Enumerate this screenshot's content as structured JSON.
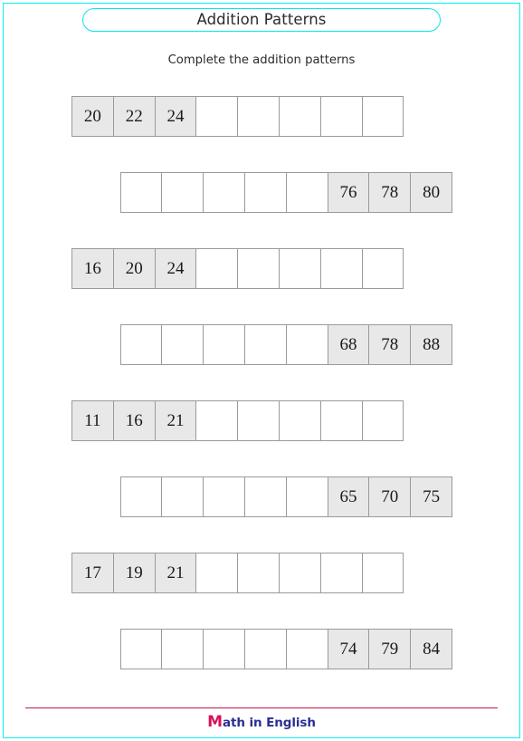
{
  "page": {
    "border_color": "#03f3f3",
    "background": "#ffffff"
  },
  "header": {
    "title": "Addition Patterns",
    "title_border_color": "#06e6f2",
    "instruction": "Complete the addition patterns"
  },
  "worksheet": {
    "cells_per_row": 8,
    "filled_cell_color": "#e8e8e8",
    "cell_border_color": "#9a9a9a",
    "rows": [
      {
        "align": "left",
        "step": 2,
        "cells": [
          {
            "value": "20",
            "filled": true
          },
          {
            "value": "22",
            "filled": true
          },
          {
            "value": "24",
            "filled": true
          },
          {
            "value": "",
            "filled": false
          },
          {
            "value": "",
            "filled": false
          },
          {
            "value": "",
            "filled": false
          },
          {
            "value": "",
            "filled": false
          },
          {
            "value": "",
            "filled": false
          }
        ]
      },
      {
        "align": "right",
        "step": 2,
        "cells": [
          {
            "value": "",
            "filled": false
          },
          {
            "value": "",
            "filled": false
          },
          {
            "value": "",
            "filled": false
          },
          {
            "value": "",
            "filled": false
          },
          {
            "value": "",
            "filled": false
          },
          {
            "value": "76",
            "filled": true
          },
          {
            "value": "78",
            "filled": true
          },
          {
            "value": "80",
            "filled": true
          }
        ]
      },
      {
        "align": "left",
        "step": 4,
        "cells": [
          {
            "value": "16",
            "filled": true
          },
          {
            "value": "20",
            "filled": true
          },
          {
            "value": "24",
            "filled": true
          },
          {
            "value": "",
            "filled": false
          },
          {
            "value": "",
            "filled": false
          },
          {
            "value": "",
            "filled": false
          },
          {
            "value": "",
            "filled": false
          },
          {
            "value": "",
            "filled": false
          }
        ]
      },
      {
        "align": "right",
        "step": 10,
        "cells": [
          {
            "value": "",
            "filled": false
          },
          {
            "value": "",
            "filled": false
          },
          {
            "value": "",
            "filled": false
          },
          {
            "value": "",
            "filled": false
          },
          {
            "value": "",
            "filled": false
          },
          {
            "value": "68",
            "filled": true
          },
          {
            "value": "78",
            "filled": true
          },
          {
            "value": "88",
            "filled": true
          }
        ]
      },
      {
        "align": "left",
        "step": 5,
        "cells": [
          {
            "value": "11",
            "filled": true
          },
          {
            "value": "16",
            "filled": true
          },
          {
            "value": "21",
            "filled": true
          },
          {
            "value": "",
            "filled": false
          },
          {
            "value": "",
            "filled": false
          },
          {
            "value": "",
            "filled": false
          },
          {
            "value": "",
            "filled": false
          },
          {
            "value": "",
            "filled": false
          }
        ]
      },
      {
        "align": "right",
        "step": 5,
        "cells": [
          {
            "value": "",
            "filled": false
          },
          {
            "value": "",
            "filled": false
          },
          {
            "value": "",
            "filled": false
          },
          {
            "value": "",
            "filled": false
          },
          {
            "value": "",
            "filled": false
          },
          {
            "value": "65",
            "filled": true
          },
          {
            "value": "70",
            "filled": true
          },
          {
            "value": "75",
            "filled": true
          }
        ]
      },
      {
        "align": "left",
        "step": 2,
        "cells": [
          {
            "value": "17",
            "filled": true
          },
          {
            "value": "19",
            "filled": true
          },
          {
            "value": "21",
            "filled": true
          },
          {
            "value": "",
            "filled": false
          },
          {
            "value": "",
            "filled": false
          },
          {
            "value": "",
            "filled": false
          },
          {
            "value": "",
            "filled": false
          },
          {
            "value": "",
            "filled": false
          }
        ]
      },
      {
        "align": "right",
        "step": 5,
        "cells": [
          {
            "value": "",
            "filled": false
          },
          {
            "value": "",
            "filled": false
          },
          {
            "value": "",
            "filled": false
          },
          {
            "value": "",
            "filled": false
          },
          {
            "value": "",
            "filled": false
          },
          {
            "value": "74",
            "filled": true
          },
          {
            "value": "79",
            "filled": true
          },
          {
            "value": "84",
            "filled": true
          }
        ]
      }
    ]
  },
  "footer": {
    "rule_color": "#b9194b",
    "logo_initial": "M",
    "logo_rest": "ath in English",
    "logo_initial_color": "#d81159",
    "logo_rest_color": "#2b2f8f"
  }
}
